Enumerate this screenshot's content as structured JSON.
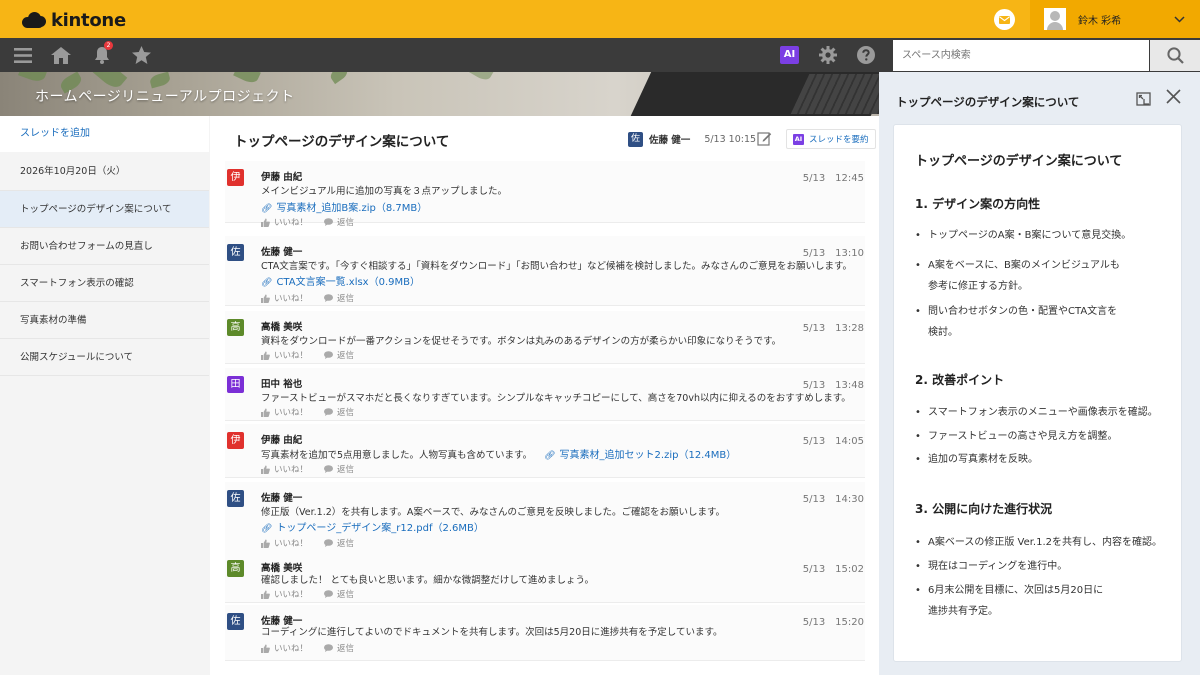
{
  "app": {
    "logo_text": "kintone"
  },
  "topbar": {
    "user_name": "鈴木 彩希"
  },
  "search": {
    "placeholder": "スペース内検索"
  },
  "nav": {
    "notification_count": "2",
    "ai_label": "AI"
  },
  "banner": {
    "title": "ホームページリニューアルプロジェクト"
  },
  "sidebar": {
    "add_thread": "スレッドを追加",
    "items": [
      {
        "label": "2026年10月20日（火）"
      },
      {
        "label": "トップページのデザイン案について"
      },
      {
        "label": "お問い合わせフォームの見直し"
      },
      {
        "label": "スマートフォン表示の確認"
      },
      {
        "label": "写真素材の準備"
      },
      {
        "label": "公開スケジュールについて"
      }
    ]
  },
  "thread": {
    "title": "トップページのデザイン案について",
    "author_initial": "佐",
    "author": "佐藤 健一",
    "time": "5/13 10:15",
    "summarize_ai": "AI",
    "summarize_label": "スレッドを要約"
  },
  "comments": [
    {
      "initial": "伊",
      "color": "#e0312d",
      "name": "伊藤 由紀",
      "time": "5/13　12:45",
      "body": "メインビジュアル用に追加の写真を３点アップしました。",
      "file": "写真素材_追加B案.zip（8.7MB）",
      "like": "いいね！",
      "reply": "返信"
    },
    {
      "initial": "佐",
      "color": "#2f4f84",
      "name": "佐藤 健一",
      "time": "5/13　13:10",
      "body": "CTA文言案です。「今すぐ相談する」「資料をダウンロード」「お問い合わせ」など候補を検討しました。みなさんのご意見をお願いします。",
      "file": "CTA文言案一覧.xlsx（0.9MB）",
      "like": "いいね！",
      "reply": "返信"
    },
    {
      "initial": "高",
      "color": "#5d8a2a",
      "name": "高橋 美咲",
      "time": "5/13　13:28",
      "body": "資料をダウンロードが一番アクションを促せそうです。ボタンは丸みのあるデザインの方が柔らかい印象になりそうです。",
      "like": "いいね！",
      "reply": "返信"
    },
    {
      "initial": "田",
      "color": "#7b2fd6",
      "name": "田中 裕也",
      "time": "5/13　13:48",
      "body": "ファーストビューがスマホだと長くなりすぎています。シンプルなキャッチコピーにして、高さを70vh以内に抑えるのをおすすめします。",
      "like": "いいね！",
      "reply": "返信"
    },
    {
      "initial": "伊",
      "color": "#e0312d",
      "name": "伊藤 由紀",
      "time": "5/13　14:05",
      "body": "写真素材を追加で5点用意しました。人物写真も含めています。",
      "file": "写真素材_追加セット2.zip（12.4MB）",
      "like": "いいね！",
      "reply": "返信"
    },
    {
      "initial": "佐",
      "color": "#2f4f84",
      "name": "佐藤 健一",
      "time": "5/13　14:30",
      "body": "修正版（Ver.1.2）を共有します。A案ベースで、みなさんのご意見を反映しました。ご確認をお願いします。",
      "file": "トップページ_デザイン案_r12.pdf（2.6MB）",
      "like": "いいね！",
      "reply": "返信"
    },
    {
      "initial": "高",
      "color": "#5d8a2a",
      "name": "高橋 美咲",
      "time": "5/13　15:02",
      "body": "確認しました！ とても良いと思います。細かな微調整だけして進めましょう。",
      "like": "いいね！",
      "reply": "返信"
    },
    {
      "initial": "佐",
      "color": "#2f4f84",
      "name": "佐藤 健一",
      "time": "5/13　15:20",
      "body": "コーディングに進行してよいのでドキュメントを共有します。次回は5月20日に進捗共有を予定しています。",
      "like": "いいね！",
      "reply": "返信"
    }
  ],
  "summary": {
    "panel_title": "トップページのデザイン案について",
    "heading": "トップページのデザイン案について",
    "sections": [
      {
        "title": "1. デザイン案の方向性",
        "items": [
          [
            "トップページのA案・B案について意見交換。"
          ],
          [
            "A案をベースに、B案のメインビジュアルも",
            "参考に修正する方針。"
          ],
          [
            "問い合わせボタンの色・配置やCTA文言を",
            "検討。"
          ]
        ]
      },
      {
        "title": "2. 改善ポイント",
        "items": [
          [
            "スマートフォン表示のメニューや画像表示を確認。"
          ],
          [
            "ファーストビューの高さや見え方を調整。"
          ],
          [
            "追加の写真素材を反映。"
          ]
        ]
      },
      {
        "title": "3. 公開に向けた進行状況",
        "items": [
          [
            "A案ベースの修正版 Ver.1.2を共有し、内容を確認。"
          ],
          [
            "現在はコーディングを進行中。"
          ],
          [
            "6月末公開を目標に、次回は5月20日に",
            "進捗共有予定。"
          ]
        ]
      }
    ]
  }
}
